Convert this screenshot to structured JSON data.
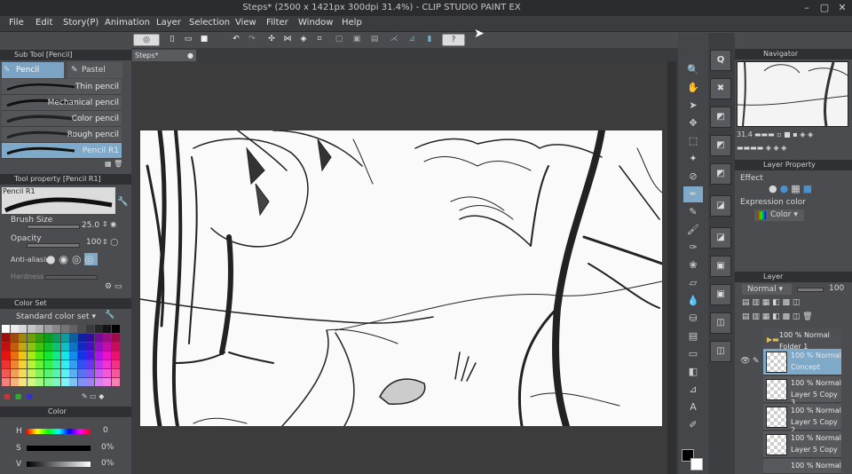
{
  "window": {
    "title": "Steps* (2500 x 1421px 300dpi 31.4%) - CLIP STUDIO PAINT EX"
  },
  "menu": [
    "File",
    "Edit",
    "Story(P)",
    "Animation",
    "Layer",
    "Selection",
    "View",
    "Filter",
    "Window",
    "Help"
  ],
  "subtool": {
    "header": "Sub Tool [Pencil]",
    "tabs": [
      "Pencil",
      "Pastel"
    ],
    "brushes": [
      "Thin pencil",
      "Mechanical pencil",
      "Color pencil",
      "Rough pencil",
      "Pencil R1"
    ]
  },
  "toolprop": {
    "header": "Tool property [Pencil R1]",
    "brush_name": "Pencil R1",
    "brush_size_label": "Brush Size",
    "brush_size_value": "25.0",
    "opacity_label": "Opacity",
    "opacity_value": "100",
    "aa_label": "Anti-aliasing",
    "hardness_label": "Hardness"
  },
  "colorset": {
    "header": "Color Set",
    "preset": "Standard color set"
  },
  "colorslider": {
    "header": "Color",
    "rows": [
      {
        "label": "H",
        "value": "0"
      },
      {
        "label": "S",
        "value": "0%"
      },
      {
        "label": "V",
        "value": "0%"
      }
    ]
  },
  "canvas": {
    "tab": "Steps*"
  },
  "navigator": {
    "header": "Navigator",
    "zoom": "31.4"
  },
  "layerprop": {
    "header": "Layer Property",
    "effect_label": "Effect",
    "expr_label": "Expression color",
    "expr_value": "Color"
  },
  "layers": {
    "header": "Layer",
    "blend": "Normal",
    "opacity": "100",
    "items": [
      {
        "line1": "100 % Normal",
        "line2": "Folder 1"
      },
      {
        "line1": "100 % Normal",
        "line2": "Concept"
      },
      {
        "line1": "100 % Normal",
        "line2": "Layer 5 Copy 3"
      },
      {
        "line1": "100 % Normal",
        "line2": "Layer 5 Copy 2"
      },
      {
        "line1": "100 % Normal",
        "line2": "Layer 5 Copy"
      },
      {
        "line1": "100 % Normal",
        "line2": ""
      }
    ]
  },
  "colors": {
    "accent": "#7aa3c4",
    "selected_row": "#7fa9c9"
  }
}
